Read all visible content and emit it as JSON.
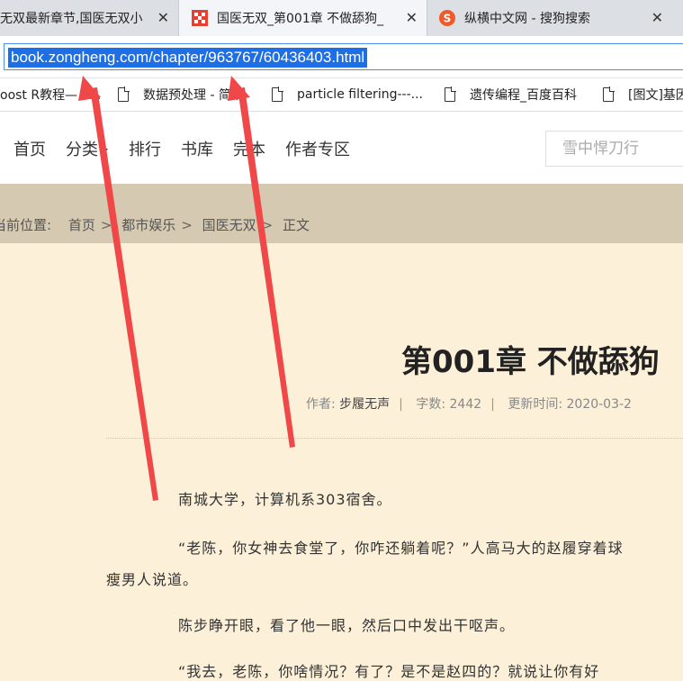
{
  "tabs": [
    {
      "title": "无双最新章节,国医无双小",
      "close": "✕",
      "active": false
    },
    {
      "title": "国医无双_第001章 不做舔狗_",
      "close": "✕",
      "active": true
    },
    {
      "title": "纵横中文网 - 搜狗搜索",
      "close": "✕",
      "active": false
    }
  ],
  "address": {
    "url": "book.zongheng.com/chapter/963767/60436403.html"
  },
  "bookmarks": [
    {
      "label": "oost R教程— x..."
    },
    {
      "label": "数据预处理 - 简书"
    },
    {
      "label": "particle filtering---..."
    },
    {
      "label": "遗传编程_百度百科"
    },
    {
      "label": "[图文]基因"
    }
  ],
  "nav": {
    "items": [
      "首页",
      "分类",
      "排行",
      "书库",
      "完本",
      "作者专区"
    ],
    "search_placeholder": "雪中悍刀行"
  },
  "breadcrumb": {
    "prefix": "当前位置:",
    "items": [
      "首页",
      "都市娱乐",
      "国医无双",
      "正文"
    ],
    "sep": ">"
  },
  "chapter": {
    "title": "第001章 不做舔狗",
    "author_label": "作者:",
    "author": "步履无声",
    "words_label": "字数:",
    "words": "2442",
    "updated_label": "更新时间:",
    "updated": "2020-03-2",
    "paragraphs": [
      "南城大学，计算机系303宿舍。",
      "“老陈，你女神去食堂了，你咋还躺着呢？”人高马大的赵履穿着球",
      "瘦男人说道。",
      "陈步睁开眼，看了他一眼，然后口中发出干呕声。",
      "“我去，老陈，你啥情况？有了？是不是赵四的？就说让你有好"
    ]
  },
  "colors": {
    "accent_arrow": "#f04848",
    "page_bg": "#fdf0d8",
    "crumb_bg": "#d6c9b1",
    "selection": "#1e6fe6"
  }
}
